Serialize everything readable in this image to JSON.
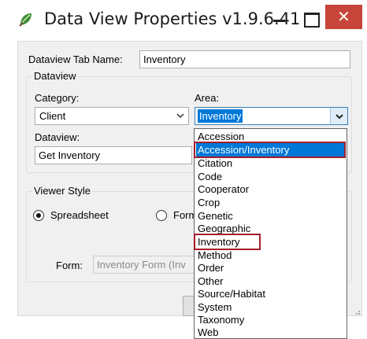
{
  "window": {
    "title": "Data View Properties v1.9.6.41",
    "close_glyph": "✕",
    "icon": "leaf-app-icon"
  },
  "form": {
    "tab_name_label": "Dataview Tab Name:",
    "tab_name_value": "Inventory",
    "dataview_group_title": "Dataview",
    "category_label": "Category:",
    "category_value": "Client",
    "area_label": "Area:",
    "area_value": "Inventory",
    "dataview_label": "Dataview:",
    "dataview_value": "Get Inventory",
    "viewer_group_title": "Viewer Style",
    "radio_spreadsheet_label": "Spreadsheet",
    "radio_form_label": "Form",
    "form_label": "Form:",
    "form_value": "Inventory Form  (Inv"
  },
  "area_dropdown": {
    "items": [
      "Accession",
      "Accession/Inventory",
      "Citation",
      "Code",
      "Cooperator",
      "Crop",
      "Genetic",
      "Geographic",
      "Inventory",
      "Method",
      "Order",
      "Other",
      "Source/Habitat",
      "System",
      "Taxonomy",
      "Web"
    ],
    "highlighted_item": "Accession/Inventory",
    "outlined_items": [
      "Accession/Inventory",
      "Inventory"
    ],
    "highlight_color": "#0078d7",
    "outline_color": "#a31d2b"
  },
  "colors": {
    "close_button": "#c7453a",
    "selection": "#0078d7"
  }
}
